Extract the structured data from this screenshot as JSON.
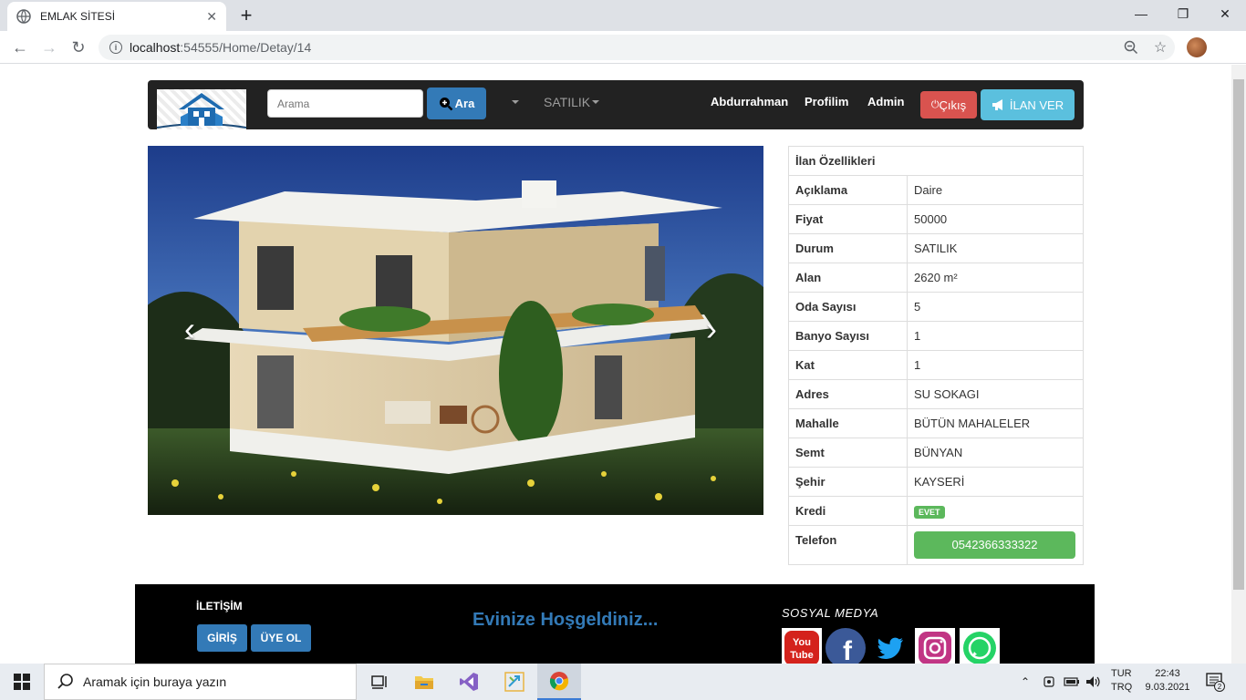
{
  "browser": {
    "tab_title": "EMLAK SİTESİ",
    "url_host": "localhost",
    "url_path": ":54555/Home/Detay/14"
  },
  "nav": {
    "search_placeholder": "Arama",
    "search_button": "Ara",
    "dropdown_label": "SATILIK",
    "user": "Abdurrahman",
    "profile": "Profilim",
    "admin": "Admin",
    "logout": "ÇıkışÇıkış",
    "logout_label": "Çıkış",
    "post_ad": "İLAN VER"
  },
  "properties": {
    "header": "İlan Özellikleri",
    "rows": [
      {
        "key": "Açıklama",
        "value": "Daire"
      },
      {
        "key": "Fiyat",
        "value": "50000"
      },
      {
        "key": "Durum",
        "value": "SATILIK"
      },
      {
        "key": "Alan",
        "value": "2620 m²"
      },
      {
        "key": "Oda Sayısı",
        "value": "5"
      },
      {
        "key": "Banyo Sayısı",
        "value": "1"
      },
      {
        "key": "Kat",
        "value": "1"
      },
      {
        "key": "Adres",
        "value": "SU SOKAGI"
      },
      {
        "key": "Mahalle",
        "value": "BÜTÜN MAHALELER"
      },
      {
        "key": "Semt",
        "value": "BÜNYAN"
      },
      {
        "key": "Şehir",
        "value": "KAYSERİ"
      }
    ],
    "credit_label": "Kredi",
    "credit_value": "EVET",
    "phone_label": "Telefon",
    "phone_value": "0542366333322"
  },
  "footer": {
    "contact_title": "İLETİŞİM",
    "login": "GİRİŞ",
    "register": "ÜYE OL",
    "welcome": "Evinize Hoşgeldiniz...",
    "social_title": "SOSYAL MEDYA"
  },
  "taskbar": {
    "search_placeholder": "Aramak için buraya yazın",
    "lang_1": "TUR",
    "lang_2": "TRQ",
    "time": "22:43",
    "date": "9.03.2021",
    "notif_count": "2"
  },
  "colors": {
    "nav_bg": "#222222",
    "primary": "#337ab7",
    "danger": "#d9534f",
    "info": "#5bc0de",
    "success": "#5cb85c"
  }
}
